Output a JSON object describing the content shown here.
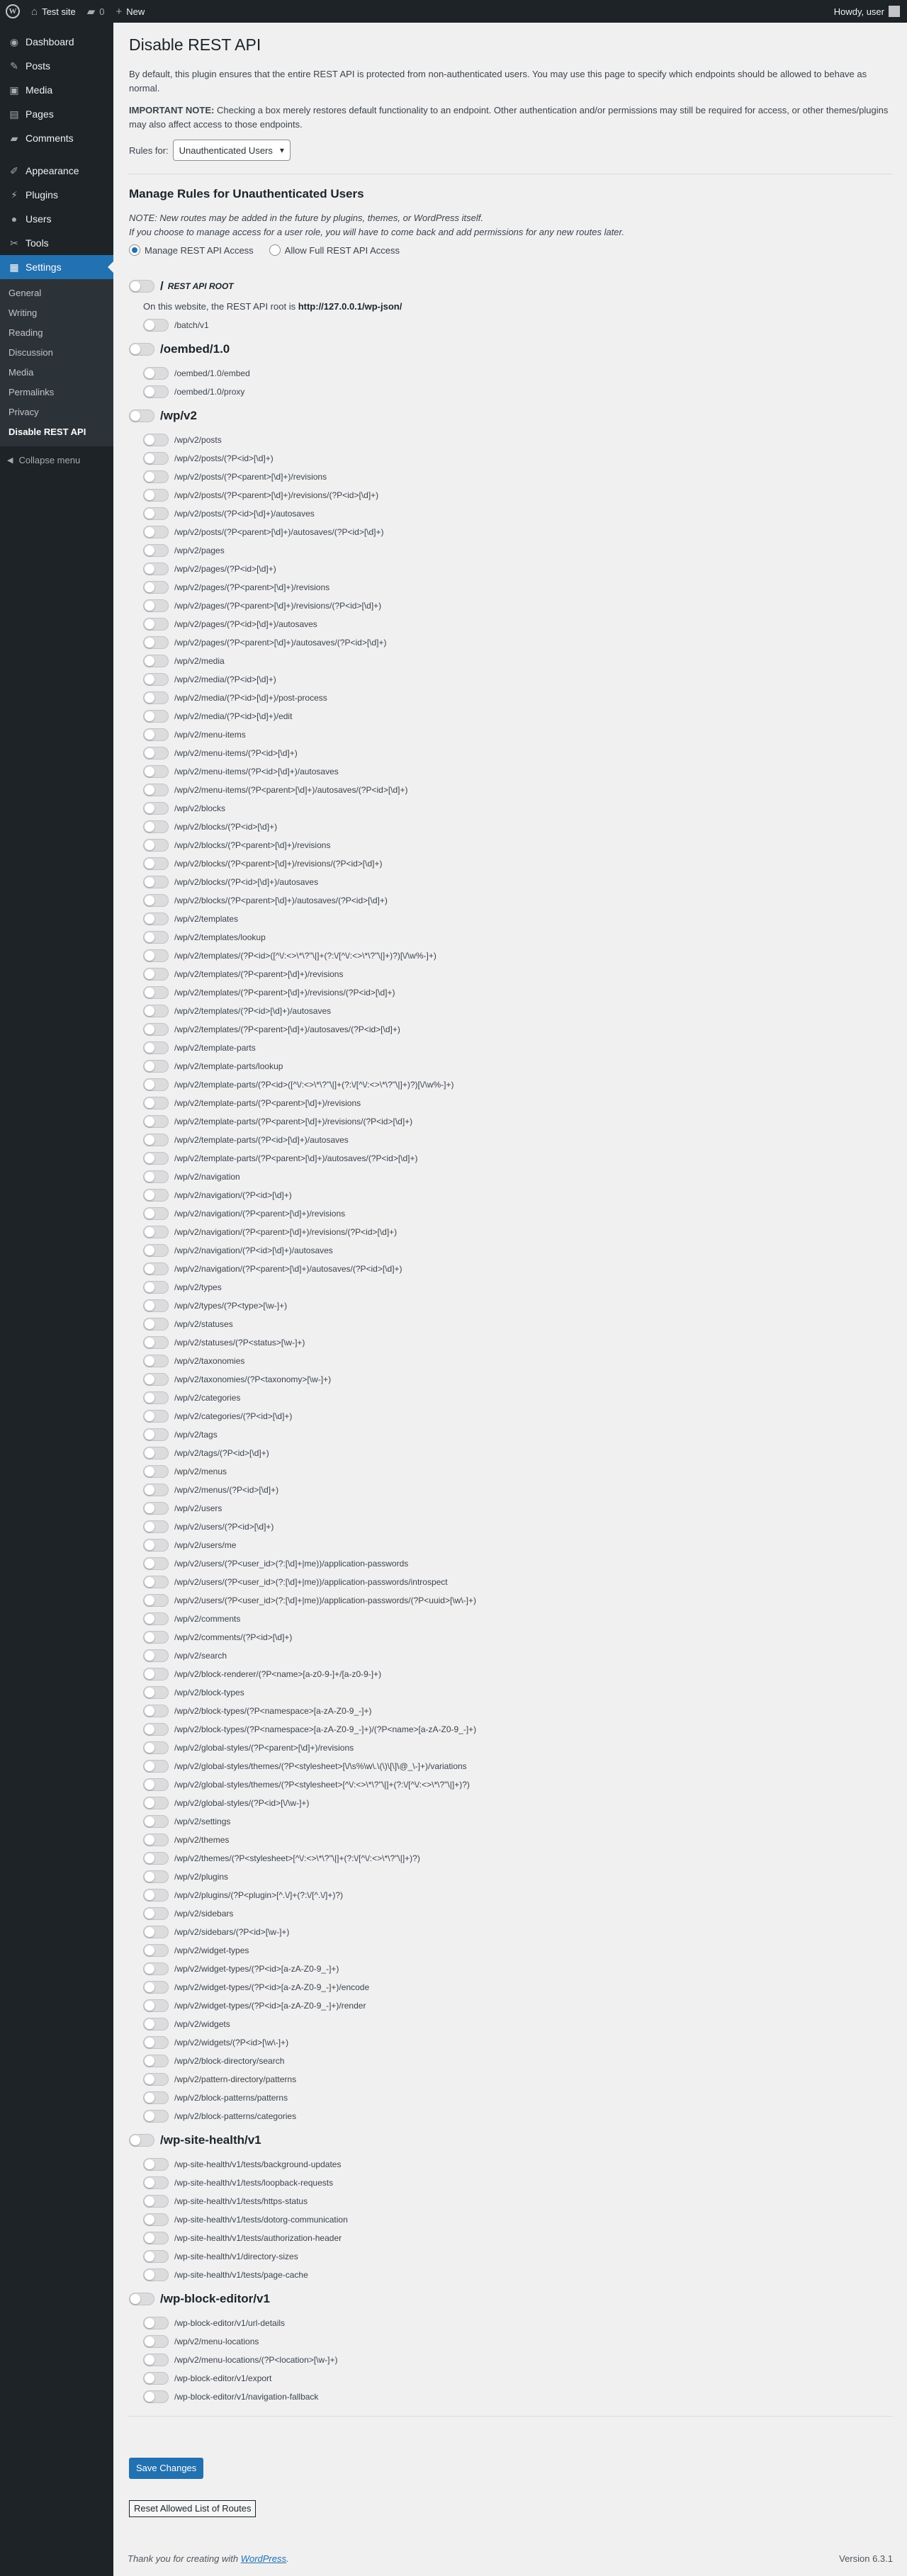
{
  "adminbar": {
    "site_name": "Test site",
    "comments_count": "0",
    "new_label": "New",
    "howdy": "Howdy, user"
  },
  "sidebar": {
    "items": [
      {
        "label": "Dashboard",
        "icon": "dashboard-icon",
        "glyph": "◉"
      },
      {
        "label": "Posts",
        "icon": "pin-icon",
        "glyph": "✎"
      },
      {
        "label": "Media",
        "icon": "media-icon",
        "glyph": "▣"
      },
      {
        "label": "Pages",
        "icon": "pages-icon",
        "glyph": "▤"
      },
      {
        "label": "Comments",
        "icon": "comments-icon",
        "glyph": "▰"
      },
      {
        "label": "Appearance",
        "icon": "brush-icon",
        "glyph": "✐"
      },
      {
        "label": "Plugins",
        "icon": "plugin-icon",
        "glyph": "⚡"
      },
      {
        "label": "Users",
        "icon": "users-icon",
        "glyph": "●"
      },
      {
        "label": "Tools",
        "icon": "wrench-icon",
        "glyph": "✂"
      },
      {
        "label": "Settings",
        "icon": "settings-icon",
        "glyph": "▦"
      }
    ],
    "submenu": [
      "General",
      "Writing",
      "Reading",
      "Discussion",
      "Media",
      "Permalinks",
      "Privacy",
      "Disable REST API"
    ],
    "collapse_label": "Collapse menu"
  },
  "page": {
    "title": "Disable REST API",
    "intro": "By default, this plugin ensures that the entire REST API is protected from non-authenticated users. You may use this page to specify which endpoints should be allowed to behave as normal.",
    "important_label": "IMPORTANT NOTE:",
    "important_text": "Checking a box merely restores default functionality to an endpoint. Other authentication and/or permissions may still be required for access, or other themes/plugins may also affect access to those endpoints.",
    "rules_for_label": "Rules for:",
    "rules_for_value": "Unauthenticated Users",
    "manage_heading": "Manage Rules for Unauthenticated Users",
    "note_line1": "NOTE: New routes may be added in the future by plugins, themes, or WordPress itself.",
    "note_line2": "If you choose to manage access for a user role, you will have to come back and add permissions for any new routes later.",
    "radio_manage": "Manage REST API Access",
    "radio_allow": "Allow Full REST API Access",
    "root_label": "/",
    "root_sub": "REST API ROOT",
    "root_info_prefix": "On this website, the REST API root is",
    "root_url": "http://127.0.0.1/wp-json/",
    "save_button": "Save Changes",
    "reset_button": "Reset Allowed List of Routes"
  },
  "route_groups": [
    {
      "name": "",
      "routes": [
        "/batch/v1"
      ]
    },
    {
      "name": "/oembed/1.0",
      "routes": [
        "/oembed/1.0/embed",
        "/oembed/1.0/proxy"
      ]
    },
    {
      "name": "/wp/v2",
      "routes": [
        "/wp/v2/posts",
        "/wp/v2/posts/(?P<id>[\\d]+)",
        "/wp/v2/posts/(?P<parent>[\\d]+)/revisions",
        "/wp/v2/posts/(?P<parent>[\\d]+)/revisions/(?P<id>[\\d]+)",
        "/wp/v2/posts/(?P<id>[\\d]+)/autosaves",
        "/wp/v2/posts/(?P<parent>[\\d]+)/autosaves/(?P<id>[\\d]+)",
        "/wp/v2/pages",
        "/wp/v2/pages/(?P<id>[\\d]+)",
        "/wp/v2/pages/(?P<parent>[\\d]+)/revisions",
        "/wp/v2/pages/(?P<parent>[\\d]+)/revisions/(?P<id>[\\d]+)",
        "/wp/v2/pages/(?P<id>[\\d]+)/autosaves",
        "/wp/v2/pages/(?P<parent>[\\d]+)/autosaves/(?P<id>[\\d]+)",
        "/wp/v2/media",
        "/wp/v2/media/(?P<id>[\\d]+)",
        "/wp/v2/media/(?P<id>[\\d]+)/post-process",
        "/wp/v2/media/(?P<id>[\\d]+)/edit",
        "/wp/v2/menu-items",
        "/wp/v2/menu-items/(?P<id>[\\d]+)",
        "/wp/v2/menu-items/(?P<id>[\\d]+)/autosaves",
        "/wp/v2/menu-items/(?P<parent>[\\d]+)/autosaves/(?P<id>[\\d]+)",
        "/wp/v2/blocks",
        "/wp/v2/blocks/(?P<id>[\\d]+)",
        "/wp/v2/blocks/(?P<parent>[\\d]+)/revisions",
        "/wp/v2/blocks/(?P<parent>[\\d]+)/revisions/(?P<id>[\\d]+)",
        "/wp/v2/blocks/(?P<id>[\\d]+)/autosaves",
        "/wp/v2/blocks/(?P<parent>[\\d]+)/autosaves/(?P<id>[\\d]+)",
        "/wp/v2/templates",
        "/wp/v2/templates/lookup",
        "/wp/v2/templates/(?P<id>([^\\/:<>\\*\\?\"\\|]+(?:\\/[^\\/:<>\\*\\?\"\\|]+)?)[\\/\\w%-]+)",
        "/wp/v2/templates/(?P<parent>[\\d]+)/revisions",
        "/wp/v2/templates/(?P<parent>[\\d]+)/revisions/(?P<id>[\\d]+)",
        "/wp/v2/templates/(?P<id>[\\d]+)/autosaves",
        "/wp/v2/templates/(?P<parent>[\\d]+)/autosaves/(?P<id>[\\d]+)",
        "/wp/v2/template-parts",
        "/wp/v2/template-parts/lookup",
        "/wp/v2/template-parts/(?P<id>([^\\/:<>\\*\\?\"\\|]+(?:\\/[^\\/:<>\\*\\?\"\\|]+)?)[\\/\\w%-]+)",
        "/wp/v2/template-parts/(?P<parent>[\\d]+)/revisions",
        "/wp/v2/template-parts/(?P<parent>[\\d]+)/revisions/(?P<id>[\\d]+)",
        "/wp/v2/template-parts/(?P<id>[\\d]+)/autosaves",
        "/wp/v2/template-parts/(?P<parent>[\\d]+)/autosaves/(?P<id>[\\d]+)",
        "/wp/v2/navigation",
        "/wp/v2/navigation/(?P<id>[\\d]+)",
        "/wp/v2/navigation/(?P<parent>[\\d]+)/revisions",
        "/wp/v2/navigation/(?P<parent>[\\d]+)/revisions/(?P<id>[\\d]+)",
        "/wp/v2/navigation/(?P<id>[\\d]+)/autosaves",
        "/wp/v2/navigation/(?P<parent>[\\d]+)/autosaves/(?P<id>[\\d]+)",
        "/wp/v2/types",
        "/wp/v2/types/(?P<type>[\\w-]+)",
        "/wp/v2/statuses",
        "/wp/v2/statuses/(?P<status>[\\w-]+)",
        "/wp/v2/taxonomies",
        "/wp/v2/taxonomies/(?P<taxonomy>[\\w-]+)",
        "/wp/v2/categories",
        "/wp/v2/categories/(?P<id>[\\d]+)",
        "/wp/v2/tags",
        "/wp/v2/tags/(?P<id>[\\d]+)",
        "/wp/v2/menus",
        "/wp/v2/menus/(?P<id>[\\d]+)",
        "/wp/v2/users",
        "/wp/v2/users/(?P<id>[\\d]+)",
        "/wp/v2/users/me",
        "/wp/v2/users/(?P<user_id>(?:[\\d]+|me))/application-passwords",
        "/wp/v2/users/(?P<user_id>(?:[\\d]+|me))/application-passwords/introspect",
        "/wp/v2/users/(?P<user_id>(?:[\\d]+|me))/application-passwords/(?P<uuid>[\\w\\-]+)",
        "/wp/v2/comments",
        "/wp/v2/comments/(?P<id>[\\d]+)",
        "/wp/v2/search",
        "/wp/v2/block-renderer/(?P<name>[a-z0-9-]+/[a-z0-9-]+)",
        "/wp/v2/block-types",
        "/wp/v2/block-types/(?P<namespace>[a-zA-Z0-9_-]+)",
        "/wp/v2/block-types/(?P<namespace>[a-zA-Z0-9_-]+)/(?P<name>[a-zA-Z0-9_-]+)",
        "/wp/v2/global-styles/(?P<parent>[\\d]+)/revisions",
        "/wp/v2/global-styles/themes/(?P<stylesheet>[\\/\\s%\\w\\.\\(\\)\\[\\]\\@_\\-]+)/variations",
        "/wp/v2/global-styles/themes/(?P<stylesheet>[^\\/:<>\\*\\?\"\\|]+(?:\\/[^\\/:<>\\*\\?\"\\|]+)?)",
        "/wp/v2/global-styles/(?P<id>[\\/\\w-]+)",
        "/wp/v2/settings",
        "/wp/v2/themes",
        "/wp/v2/themes/(?P<stylesheet>[^\\/:<>\\*\\?\"\\|]+(?:\\/[^\\/:<>\\*\\?\"\\|]+)?)",
        "/wp/v2/plugins",
        "/wp/v2/plugins/(?P<plugin>[^.\\/]+(?:\\/[^.\\/]+)?)",
        "/wp/v2/sidebars",
        "/wp/v2/sidebars/(?P<id>[\\w-]+)",
        "/wp/v2/widget-types",
        "/wp/v2/widget-types/(?P<id>[a-zA-Z0-9_-]+)",
        "/wp/v2/widget-types/(?P<id>[a-zA-Z0-9_-]+)/encode",
        "/wp/v2/widget-types/(?P<id>[a-zA-Z0-9_-]+)/render",
        "/wp/v2/widgets",
        "/wp/v2/widgets/(?P<id>[\\w\\-]+)",
        "/wp/v2/block-directory/search",
        "/wp/v2/pattern-directory/patterns",
        "/wp/v2/block-patterns/patterns",
        "/wp/v2/block-patterns/categories"
      ]
    },
    {
      "name": "/wp-site-health/v1",
      "routes": [
        "/wp-site-health/v1/tests/background-updates",
        "/wp-site-health/v1/tests/loopback-requests",
        "/wp-site-health/v1/tests/https-status",
        "/wp-site-health/v1/tests/dotorg-communication",
        "/wp-site-health/v1/tests/authorization-header",
        "/wp-site-health/v1/directory-sizes",
        "/wp-site-health/v1/tests/page-cache"
      ]
    },
    {
      "name": "/wp-block-editor/v1",
      "routes": [
        "/wp-block-editor/v1/url-details",
        "/wp/v2/menu-locations",
        "/wp/v2/menu-locations/(?P<location>[\\w-]+)",
        "/wp-block-editor/v1/export",
        "/wp-block-editor/v1/navigation-fallback"
      ]
    }
  ],
  "footer": {
    "thanks_prefix": "Thank you for creating with",
    "thanks_link": "WordPress",
    "thanks_suffix": ".",
    "version": "Version 6.3.1"
  }
}
